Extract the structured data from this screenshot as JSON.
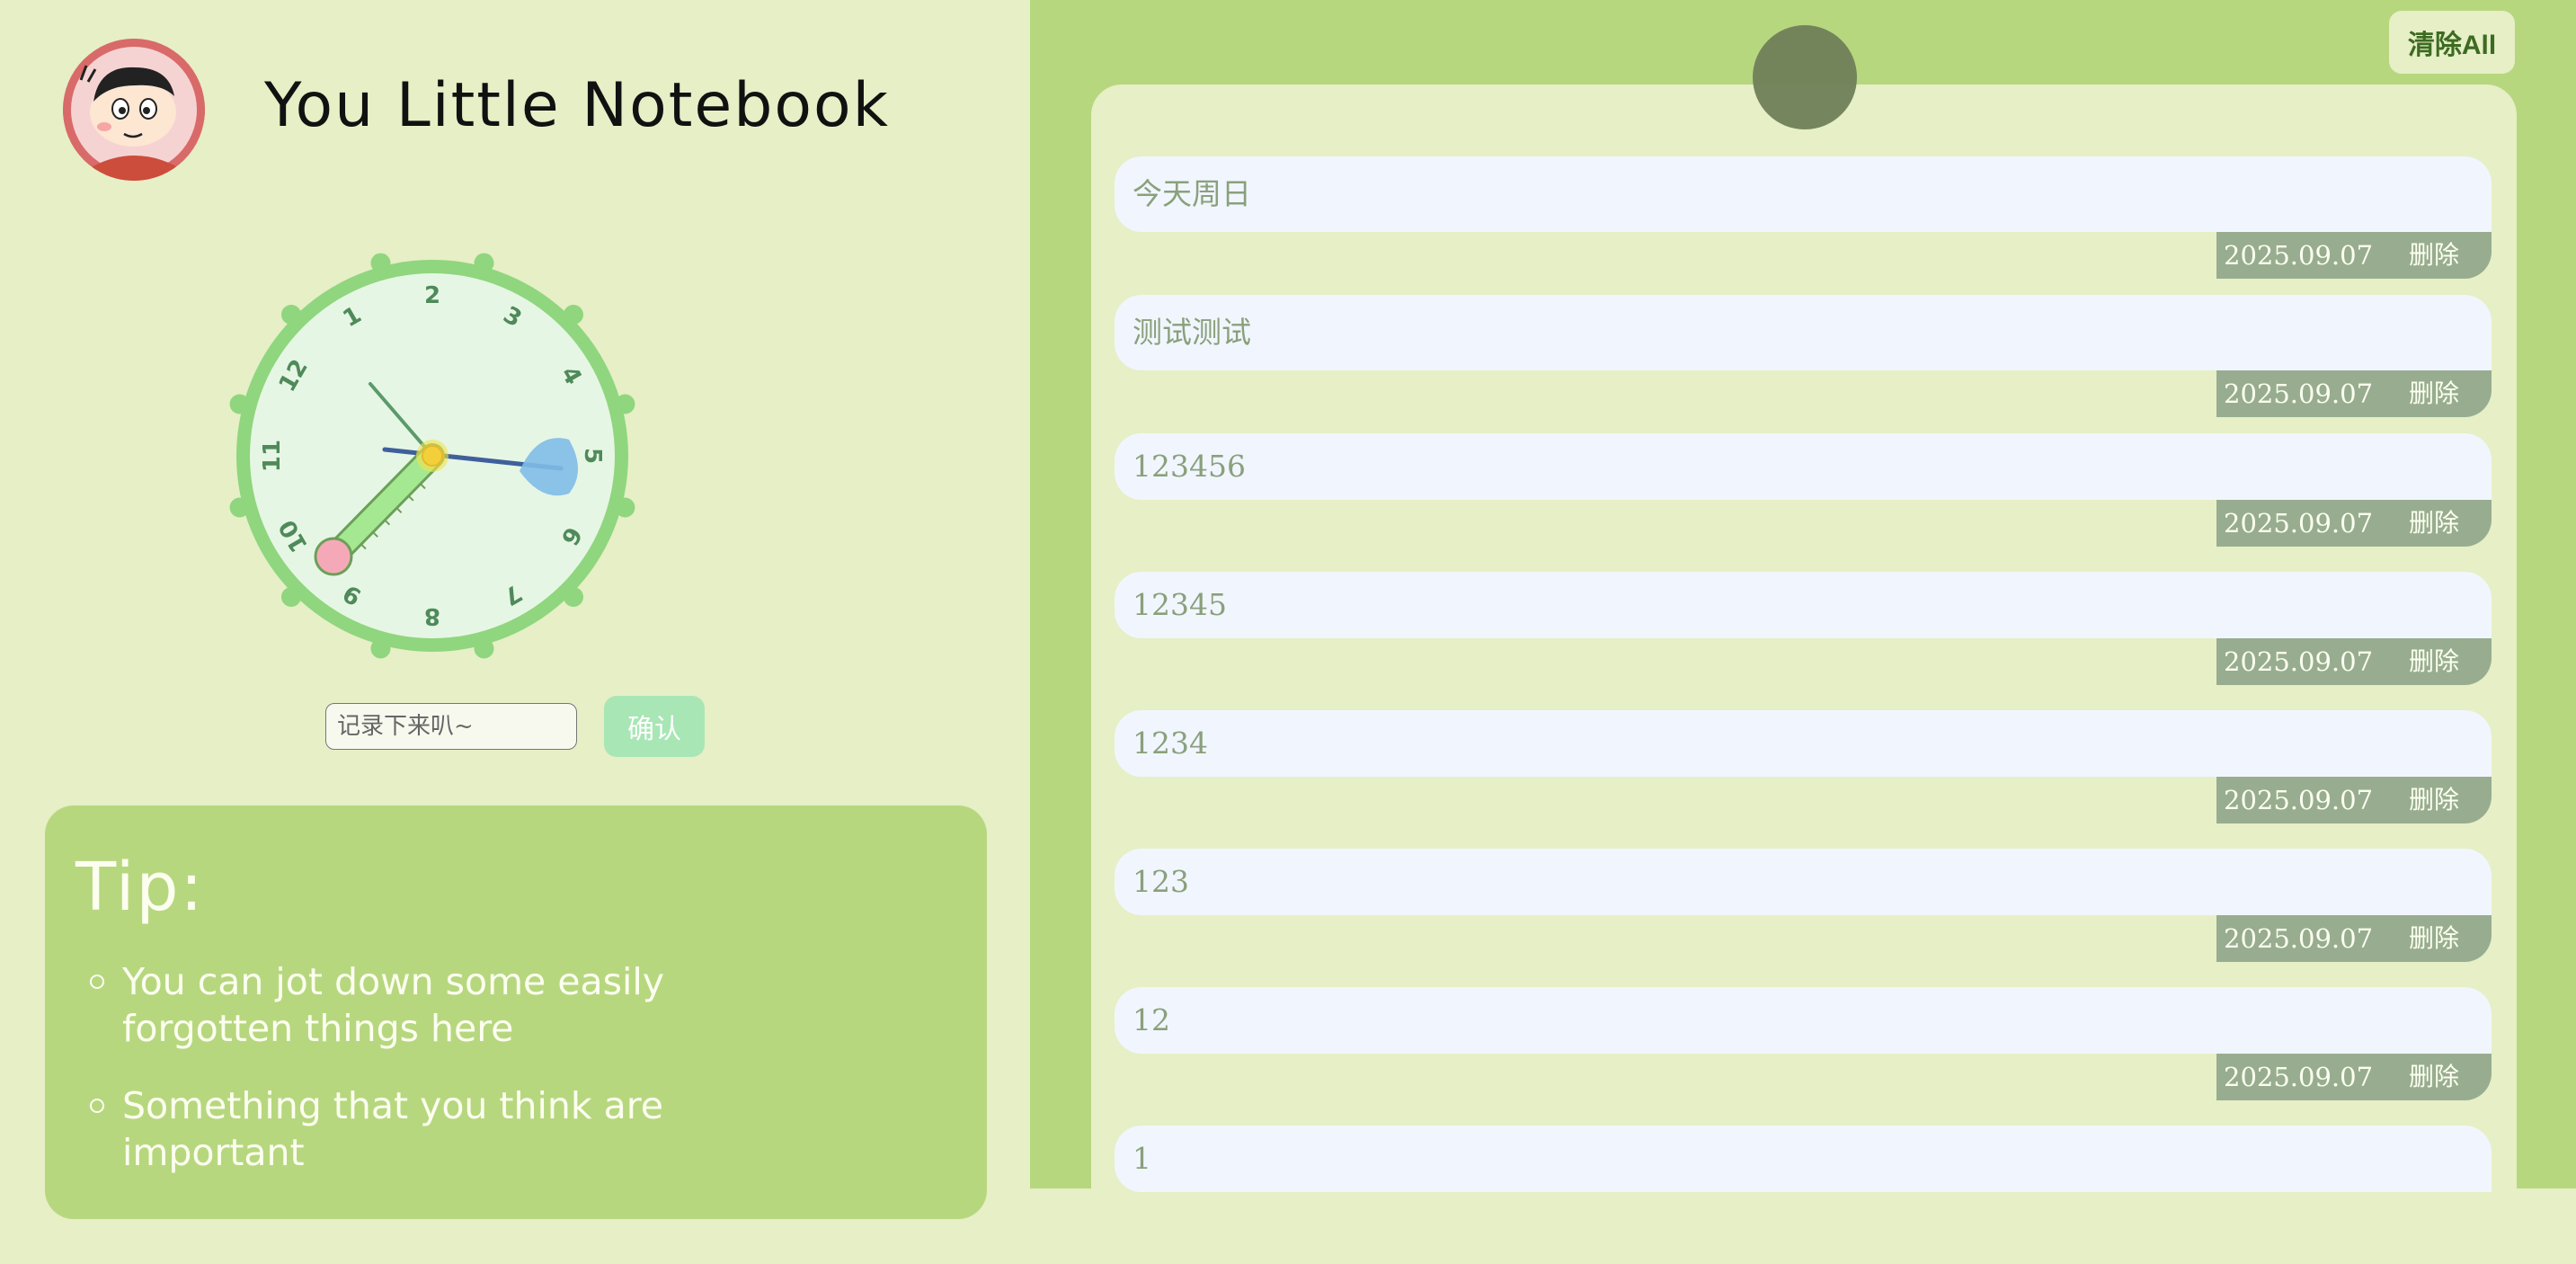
{
  "app": {
    "title": "You Little Notebook"
  },
  "clock": {
    "numbers": [
      "1",
      "2",
      "3",
      "4",
      "5",
      "6",
      "7",
      "8",
      "9",
      "10",
      "11",
      "12"
    ]
  },
  "input": {
    "placeholder": "记录下来叭~",
    "value": ""
  },
  "confirm_label": "确认",
  "tip": {
    "title": "Tip:",
    "items": [
      "You can jot down some easily forgotten things here",
      "Something that you think are important"
    ]
  },
  "clear_all_label": "清除All",
  "notes": [
    {
      "text": "今天周日",
      "date": "2025.09.07",
      "delete_label": "删除"
    },
    {
      "text": "测试测试",
      "date": "2025.09.07",
      "delete_label": "删除"
    },
    {
      "text": "123456",
      "date": "2025.09.07",
      "delete_label": "删除"
    },
    {
      "text": "12345",
      "date": "2025.09.07",
      "delete_label": "删除"
    },
    {
      "text": "1234",
      "date": "2025.09.07",
      "delete_label": "删除"
    },
    {
      "text": "123",
      "date": "2025.09.07",
      "delete_label": "删除"
    },
    {
      "text": "12",
      "date": "2025.09.07",
      "delete_label": "删除"
    },
    {
      "text": "1",
      "date": "",
      "delete_label": ""
    }
  ],
  "colors": {
    "background": "#e6efc6",
    "panel": "#b7d77f",
    "note_bg": "#f1f6fe",
    "meta_bg": "#98ad8f",
    "clock_ring": "#8fd67e"
  }
}
